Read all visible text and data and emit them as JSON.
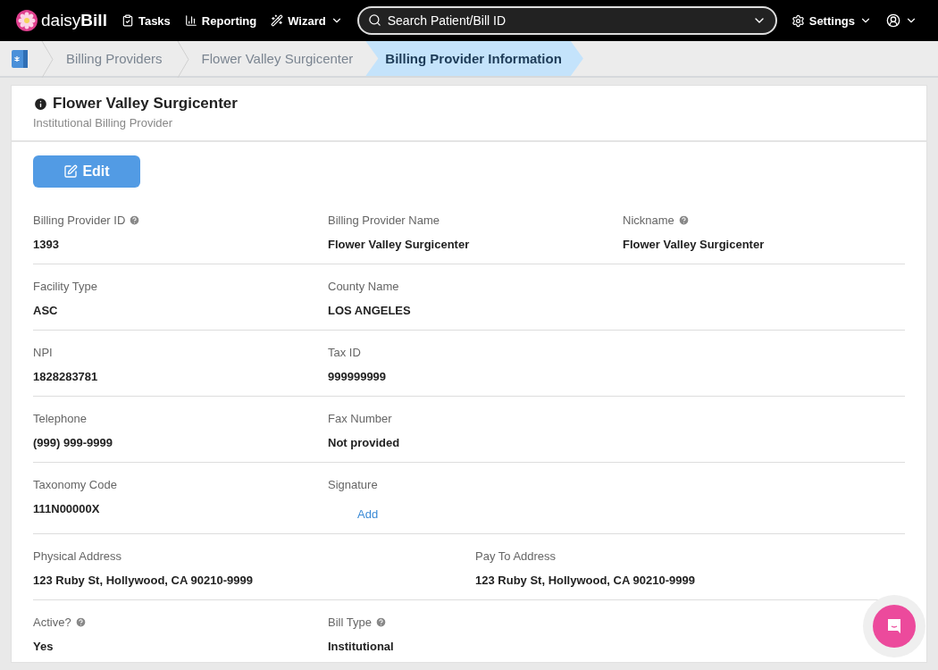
{
  "nav": {
    "brand_light": "daisy",
    "brand_bold": "Bill",
    "links": [
      {
        "kind": "tasks",
        "label": "Tasks",
        "dropdown": false
      },
      {
        "kind": "reporting",
        "label": "Reporting",
        "dropdown": false
      },
      {
        "kind": "wizard",
        "label": "Wizard",
        "dropdown": true
      }
    ],
    "search": {
      "placeholder": "Search Patient/Bill ID"
    },
    "settings": {
      "label": "Settings"
    }
  },
  "breadcrumbs": [
    {
      "label": "Billing Providers",
      "selected": false
    },
    {
      "label": "Flower Valley Surgicenter",
      "selected": false
    },
    {
      "label": "Billing Provider Information",
      "selected": true
    }
  ],
  "header": {
    "title": "Flower Valley Surgicenter",
    "subtitle": "Institutional Billing Provider"
  },
  "edit_button": "Edit",
  "rows": [
    {
      "kind": "standard",
      "fields": [
        {
          "label": "Billing Provider ID",
          "help": true,
          "kind": "text",
          "value": "1393"
        },
        {
          "label": "Billing Provider Name",
          "help": false,
          "kind": "text",
          "value": "Flower Valley Surgicenter"
        },
        {
          "label": "Nickname",
          "help": true,
          "kind": "text",
          "value": "Flower Valley Surgicenter"
        }
      ]
    },
    {
      "kind": "standard",
      "fields": [
        {
          "label": "Facility Type",
          "help": false,
          "kind": "text",
          "value": "ASC"
        },
        {
          "label": "County Name",
          "help": false,
          "kind": "text",
          "value": "LOS ANGELES"
        }
      ]
    },
    {
      "kind": "standard",
      "fields": [
        {
          "label": "NPI",
          "help": false,
          "kind": "text",
          "value": "1828283781"
        },
        {
          "label": "Tax ID",
          "help": false,
          "kind": "text",
          "value": "999999999"
        }
      ]
    },
    {
      "kind": "standard",
      "fields": [
        {
          "label": "Telephone",
          "help": false,
          "kind": "text",
          "value": "(999) 999-9999"
        },
        {
          "label": "Fax Number",
          "help": false,
          "kind": "text",
          "value": "Not provided"
        }
      ]
    },
    {
      "kind": "standard",
      "fields": [
        {
          "label": "Taxonomy Code",
          "help": false,
          "kind": "text",
          "value": "111N00000X"
        },
        {
          "label": "Signature",
          "help": false,
          "kind": "link",
          "value": "Add"
        }
      ]
    },
    {
      "kind": "wide",
      "fields": [
        {
          "label": "Physical Address",
          "help": false,
          "kind": "text",
          "value": "123 Ruby St, Hollywood, CA 90210-9999"
        },
        {
          "label": "Pay To Address",
          "help": false,
          "kind": "text",
          "value": "123 Ruby St, Hollywood, CA 90210-9999"
        }
      ]
    },
    {
      "kind": "standard",
      "fields": [
        {
          "label": "Active?",
          "help": true,
          "kind": "text",
          "value": "Yes"
        },
        {
          "label": "Bill Type",
          "help": true,
          "kind": "text",
          "value": "Institutional"
        }
      ]
    }
  ]
}
